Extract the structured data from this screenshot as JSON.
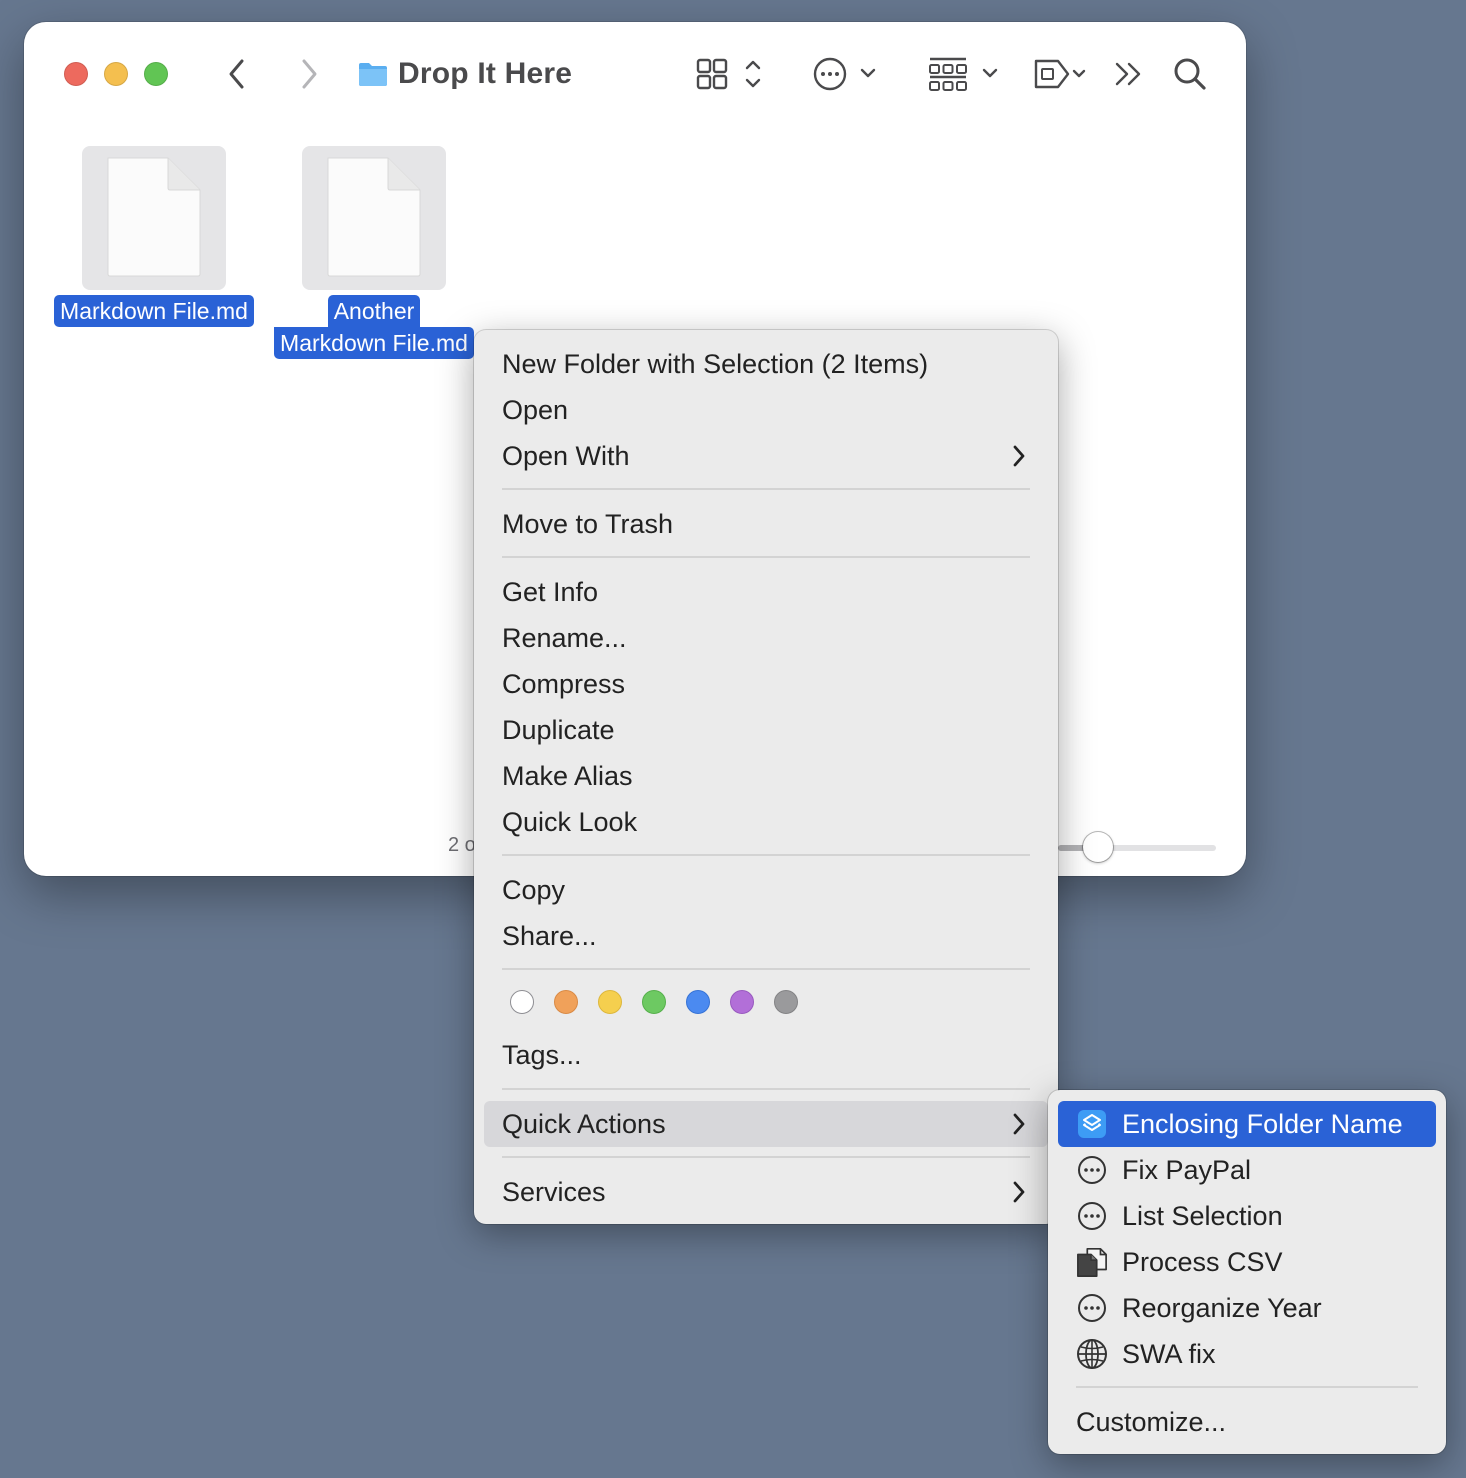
{
  "window": {
    "title": "Drop It Here",
    "status_text": "2 o"
  },
  "toolbar": {
    "icons": [
      "back-chevron-icon",
      "forward-chevron-icon",
      "folder-icon",
      "icon-view-grid-icon",
      "action-ellipsis-icon",
      "group-by-icon",
      "tag-icon",
      "more-toolbar-icon",
      "search-icon"
    ]
  },
  "files": [
    {
      "name_lines": [
        "Markdown File.md"
      ]
    },
    {
      "name_lines": [
        "Another",
        "Markdown File.md"
      ]
    }
  ],
  "context_menu": {
    "items": [
      {
        "label": "New Folder with Selection (2 Items)"
      },
      {
        "label": "Open"
      },
      {
        "label": "Open With",
        "submenu": true
      },
      {
        "label": "Move to Trash"
      },
      {
        "label": "Get Info"
      },
      {
        "label": "Rename..."
      },
      {
        "label": "Compress"
      },
      {
        "label": "Duplicate"
      },
      {
        "label": "Make Alias"
      },
      {
        "label": "Quick Look"
      },
      {
        "label": "Copy"
      },
      {
        "label": "Share..."
      },
      {
        "label": "Tags..."
      },
      {
        "label": "Quick Actions",
        "submenu": true,
        "highlighted": true
      },
      {
        "label": "Services",
        "submenu": true
      }
    ],
    "tag_colors": [
      "#ffffff",
      "#f0a15a",
      "#f5cf4e",
      "#6dc962",
      "#4b8af0",
      "#b26fd8",
      "#9a9a9c"
    ]
  },
  "quick_actions": {
    "items": [
      {
        "label": "Enclosing Folder Name",
        "icon": "shortcuts-icon",
        "active": true
      },
      {
        "label": "Fix PayPal",
        "icon": "ellipsis-circle-icon"
      },
      {
        "label": "List Selection",
        "icon": "ellipsis-circle-icon"
      },
      {
        "label": "Process CSV",
        "icon": "documents-icon"
      },
      {
        "label": "Reorganize Year",
        "icon": "ellipsis-circle-icon"
      },
      {
        "label": "SWA fix",
        "icon": "globe-icon"
      }
    ],
    "customize_label": "Customize..."
  },
  "colors": {
    "desktop": "#66778f",
    "selection": "#2a62d6",
    "menu_bg": "#ebebeb"
  }
}
